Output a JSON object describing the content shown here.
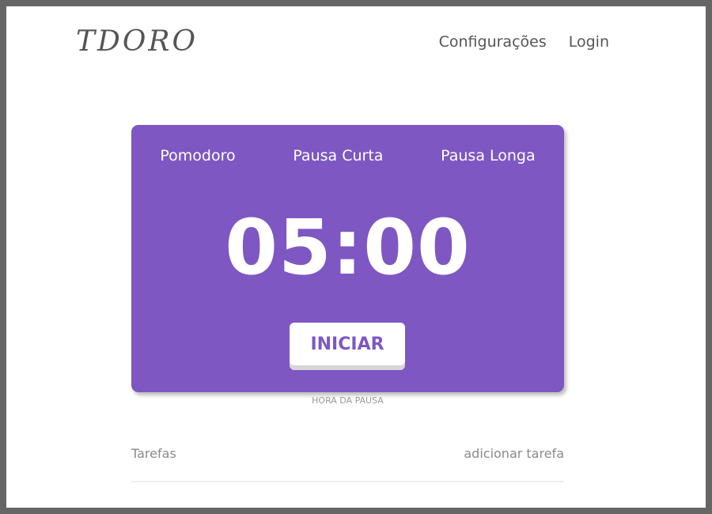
{
  "header": {
    "logo": "TDORO",
    "nav": {
      "settings": "Configurações",
      "login": "Login"
    }
  },
  "timer_card": {
    "tabs": [
      "Pomodoro",
      "Pausa Curta",
      "Pausa Longa"
    ],
    "time": "05:00",
    "start_label": "INICIAR"
  },
  "pause_label": "HORA DA PAUSA",
  "tasks": {
    "title": "Tarefas",
    "add_label": "adicionar tarefa"
  },
  "colors": {
    "accent": "#7e57c2",
    "frame": "#666666",
    "text_muted": "#8a8a8a"
  }
}
